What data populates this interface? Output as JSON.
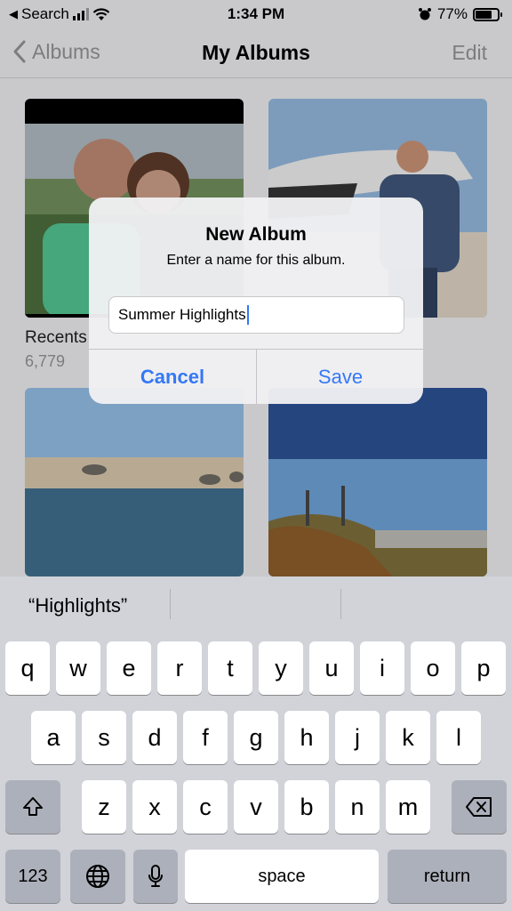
{
  "status_bar": {
    "back_app": "Search",
    "time": "1:34 PM",
    "battery_percent": "77%",
    "battery_level": 0.77
  },
  "nav": {
    "back_label": "Albums",
    "title": "My Albums",
    "edit_label": "Edit"
  },
  "albums": [
    {
      "label": "Recents",
      "count": "6,779"
    },
    {
      "label": "",
      "count": ""
    },
    {
      "label": "",
      "count": ""
    },
    {
      "label": "",
      "count": ""
    }
  ],
  "dialog": {
    "title": "New Album",
    "message": "Enter a name for this album.",
    "input_value": "Summer Highlights",
    "cancel_label": "Cancel",
    "save_label": "Save"
  },
  "keyboard": {
    "suggestions": [
      "“Highlights”",
      "",
      ""
    ],
    "row1": [
      "q",
      "w",
      "e",
      "r",
      "t",
      "y",
      "u",
      "i",
      "o",
      "p"
    ],
    "row2": [
      "a",
      "s",
      "d",
      "f",
      "g",
      "h",
      "j",
      "k",
      "l"
    ],
    "row3": [
      "z",
      "x",
      "c",
      "v",
      "b",
      "n",
      "m"
    ],
    "numbers_label": "123",
    "space_label": "space",
    "return_label": "return"
  },
  "colors": {
    "accent": "#3478f6",
    "muted": "#8e8e93"
  }
}
